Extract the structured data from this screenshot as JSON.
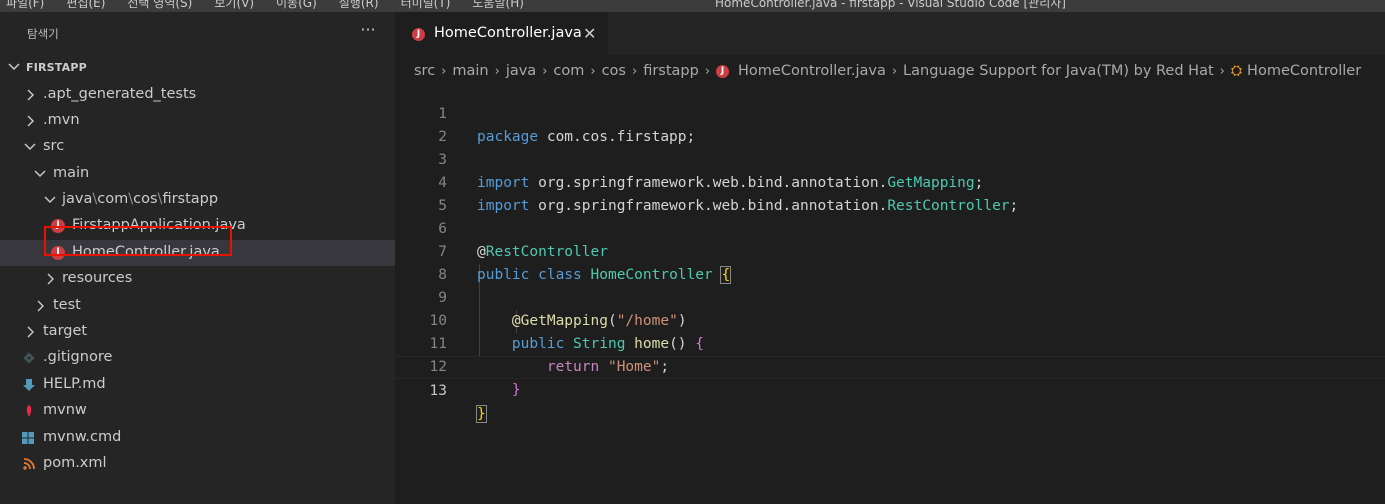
{
  "window": {
    "menu_items": [
      "파일(F)",
      "편집(E)",
      "선택 영역(S)",
      "보기(V)",
      "이동(G)",
      "실행(R)",
      "터미널(T)",
      "도움말(H)"
    ],
    "title": "HomeController.java - firstapp - Visual Studio Code [관리자]"
  },
  "sidebar": {
    "title": "탐색기",
    "more_label": "···",
    "project_name": "FIRSTAPP",
    "items": [
      {
        "label": ".apt_generated_tests"
      },
      {
        "label": ".mvn"
      },
      {
        "label": "src"
      },
      {
        "label": "main"
      },
      {
        "label_parts": [
          "java",
          "\\",
          "com",
          "\\",
          "cos",
          "\\",
          "firstapp"
        ]
      },
      {
        "label": "FirstappApplication.java"
      },
      {
        "label": "HomeController.java"
      },
      {
        "label": "resources"
      },
      {
        "label": "test"
      },
      {
        "label": "target"
      },
      {
        "label": ".gitignore"
      },
      {
        "label": "HELP.md"
      },
      {
        "label": "mvnw"
      },
      {
        "label": "mvnw.cmd"
      },
      {
        "label": "pom.xml"
      }
    ]
  },
  "editor": {
    "tab": {
      "label": "HomeController.java",
      "close": "✕",
      "icon_letter": "J"
    },
    "breadcrumb": [
      "src",
      "main",
      "java",
      "com",
      "cos",
      "firstapp",
      "HomeController.java",
      "Language Support for Java(TM) by Red Hat",
      "HomeController"
    ],
    "line_numbers": [
      "1",
      "2",
      "3",
      "4",
      "5",
      "6",
      "7",
      "8",
      "9",
      "10",
      "11",
      "12",
      "13"
    ],
    "code": {
      "l1_kw": "package",
      "l1_rest": " com.cos.firstapp;",
      "l3_kw": "import",
      "l3_pkg": " org.springframework.web.bind.annotation.",
      "l3_type": "GetMapping",
      "l3_end": ";",
      "l4_kw": "import",
      "l4_pkg": " org.springframework.web.bind.annotation.",
      "l4_type": "RestController",
      "l4_end": ";",
      "l6_at": "@",
      "l6_ann": "RestController",
      "l7_kw1": "public",
      "l7_kw2": " class ",
      "l7_type": "HomeController",
      "l7_brace": "{",
      "l9_at": "@",
      "l9_ann": "GetMapping",
      "l9_p1": "(",
      "l9_str": "\"/home\"",
      "l9_p2": ")",
      "l10_kw": "public",
      "l10_type": " String ",
      "l10_fn": "home",
      "l10_par": "()",
      "l10_brace": "{",
      "l11_kw": "return",
      "l11_str": " \"Home\"",
      "l11_end": ";",
      "l12_brace": "}",
      "l13_brace": "}"
    }
  },
  "colors": {
    "java_icon": "#cc3e44",
    "keyword": "#569cd6",
    "type": "#4ec9b0",
    "string": "#ce9178",
    "annotation": "#dcdcaa",
    "selection_box": "#e51400"
  }
}
